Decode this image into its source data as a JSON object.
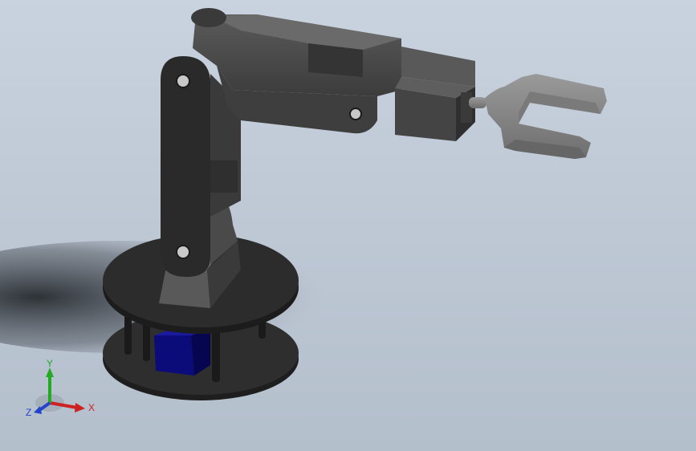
{
  "viewport": {
    "background_top": "#c9d3df",
    "background_bottom": "#b4bfcc"
  },
  "model": {
    "body_color": "#4a4a4a",
    "dark_color": "#2a2a2a",
    "gripper_color": "#8a8a8a",
    "servo_color": "#0a0a8a"
  },
  "triad": {
    "x_label": "X",
    "y_label": "Y",
    "z_label": "Z",
    "x_color": "#cc2222",
    "y_color": "#22aa22",
    "z_color": "#2244cc"
  }
}
